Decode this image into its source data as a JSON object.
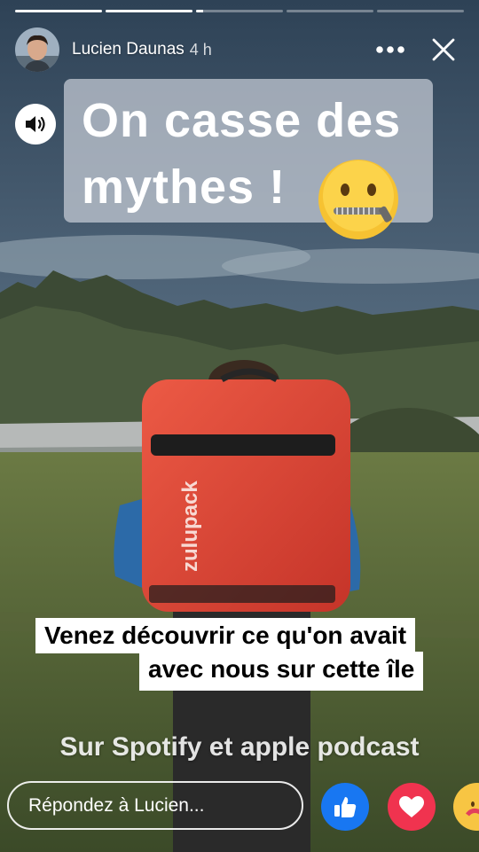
{
  "story": {
    "progress": [
      1,
      1,
      0.08,
      0,
      0
    ]
  },
  "header": {
    "user_name": "Lucien Daunas",
    "time": "4 h",
    "more_icon": "more-dots-icon",
    "close_icon": "close-icon"
  },
  "sound": {
    "icon": "speaker-icon"
  },
  "title": {
    "line1": "On casse des",
    "line2": "mythes !",
    "emoji": "zipper-mouth-face"
  },
  "captions": {
    "line1": "Venez découvrir ce qu'on avait",
    "line2": "avec nous sur cette île"
  },
  "subtitle": "Sur Spotify et apple podcast",
  "reply": {
    "placeholder": "Répondez à Lucien..."
  },
  "reactions": [
    "like",
    "love",
    "care"
  ],
  "colors": {
    "backpack": "#e1443a",
    "like": "#1877f2",
    "love": "#f0334f",
    "care": "#f7c543"
  }
}
